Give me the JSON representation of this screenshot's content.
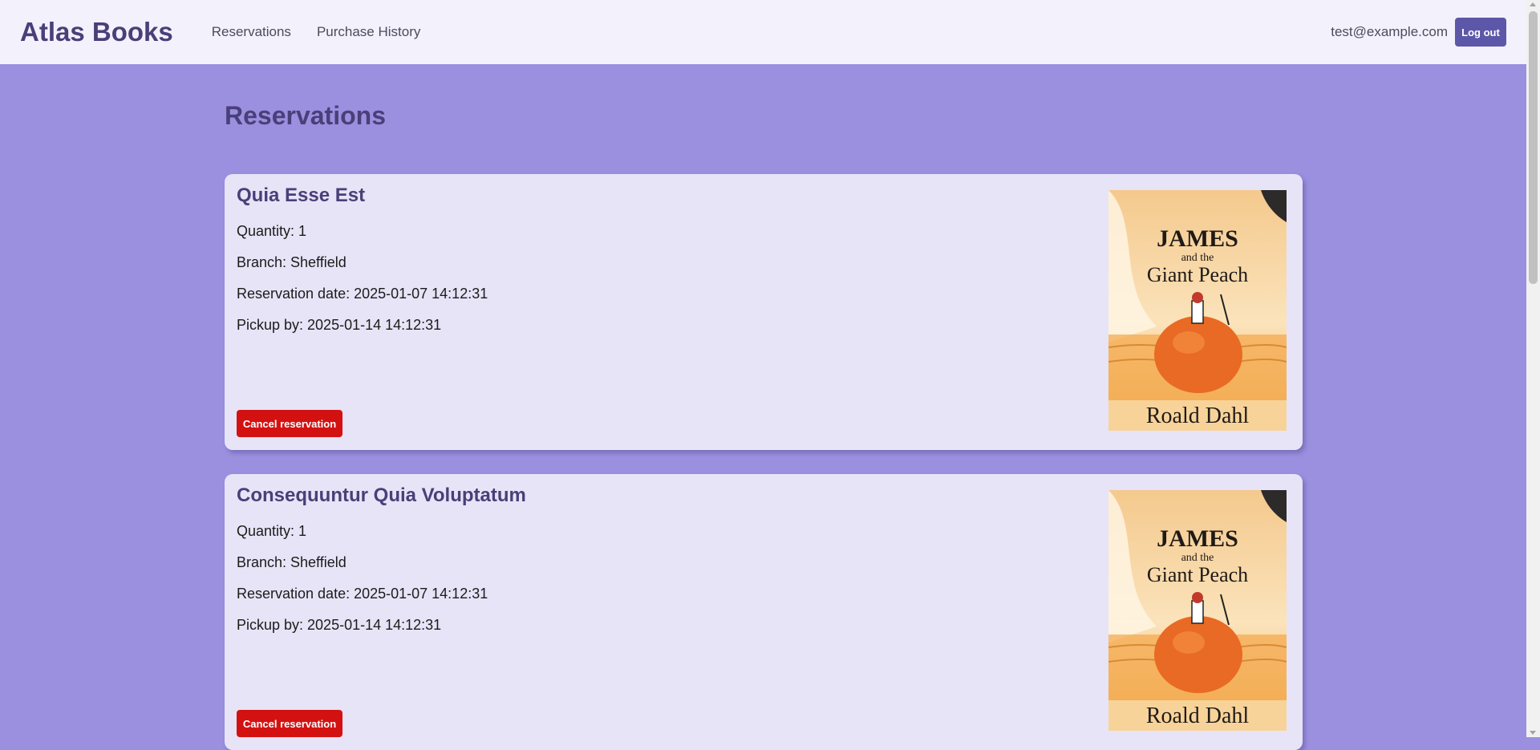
{
  "nav": {
    "brand": "Atlas Books",
    "links": [
      "Reservations",
      "Purchase History"
    ],
    "user_email": "test@example.com",
    "logout_label": "Log out"
  },
  "page": {
    "title": "Reservations"
  },
  "reservations": [
    {
      "title": "Quia Esse Est",
      "quantity": "Quantity: 1",
      "branch": "Branch: Sheffield",
      "reservation_date": "Reservation date: 2025-01-07 14:12:31",
      "pickup_by": "Pickup by: 2025-01-14 14:12:31",
      "cancel_label": "Cancel reservation",
      "cover": {
        "line1": "JAMES",
        "line2": "and the",
        "line3": "Giant Peach",
        "author": "Roald Dahl"
      }
    },
    {
      "title": "Consequuntur Quia Voluptatum",
      "quantity": "Quantity: 1",
      "branch": "Branch: Sheffield",
      "reservation_date": "Reservation date: 2025-01-07 14:12:31",
      "pickup_by": "Pickup by: 2025-01-14 14:12:31",
      "cancel_label": "Cancel reservation",
      "cover": {
        "line1": "JAMES",
        "line2": "and the",
        "line3": "Giant Peach",
        "author": "Roald Dahl"
      }
    }
  ],
  "colors": {
    "page_background": "#9b90df",
    "navbar_background": "#f3f1fc",
    "heading": "#4a3f78",
    "card_background": "#e7e4f7",
    "cancel_button": "#d41111",
    "logout_button": "#5c57a8"
  }
}
